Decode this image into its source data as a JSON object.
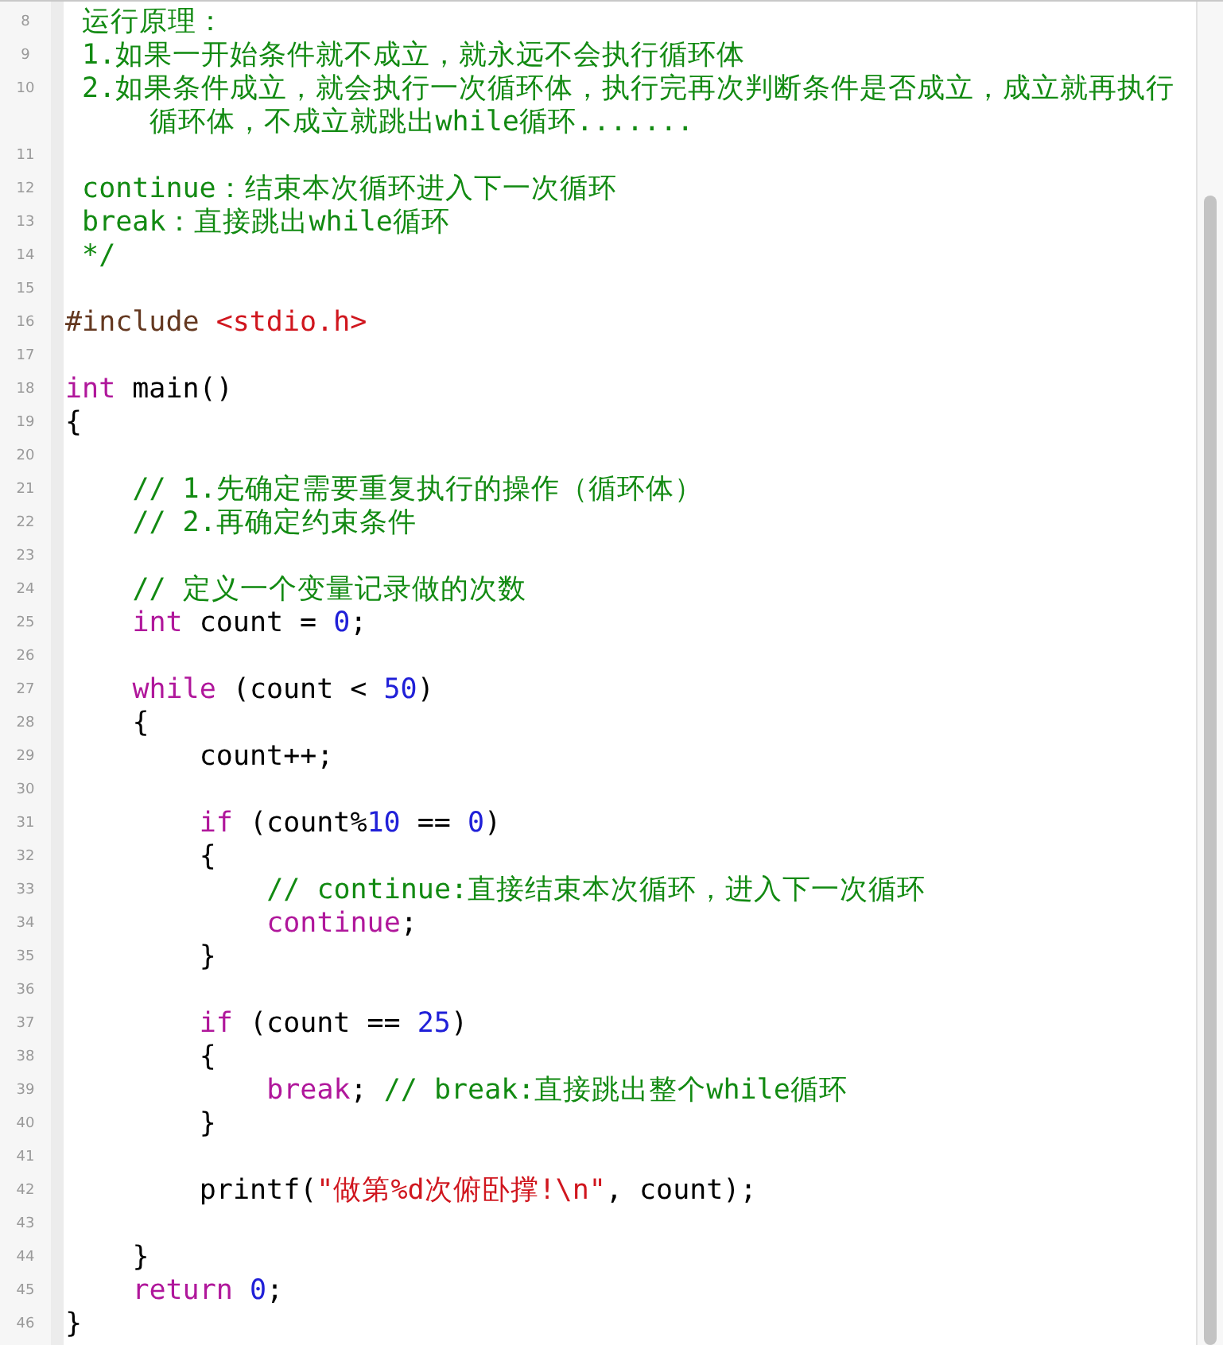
{
  "editor": {
    "lines": [
      {
        "number": "8",
        "kind": "doc",
        "tokens": [
          {
            "kind": "comment",
            "text": "运行原理："
          }
        ]
      },
      {
        "number": "9",
        "kind": "doc",
        "tokens": [
          {
            "kind": "comment",
            "text": "1.如果一开始条件就不成立，就永远不会执行循环体"
          }
        ]
      },
      {
        "number": "10",
        "kind": "doc",
        "tokens": [
          {
            "kind": "comment",
            "text": "2.如果条件成立，就会执行一次循环体，执行完再次判断条件是否成立，成立就再执行"
          }
        ],
        "continuation": [
          {
            "kind": "comment",
            "text": "循环体，不成立就跳出while循环......."
          }
        ]
      },
      {
        "number": "11",
        "kind": "code"
      },
      {
        "number": "12",
        "kind": "doc",
        "tokens": [
          {
            "kind": "comment",
            "text": "continue：结束本次循环进入下一次循环"
          }
        ]
      },
      {
        "number": "13",
        "kind": "doc",
        "tokens": [
          {
            "kind": "comment",
            "text": "break：直接跳出while循环"
          }
        ]
      },
      {
        "number": "14",
        "kind": "doc",
        "tokens": [
          {
            "kind": "comment",
            "text": "*/"
          }
        ]
      },
      {
        "number": "15",
        "kind": "code"
      },
      {
        "number": "16",
        "kind": "code",
        "tokens": [
          {
            "kind": "preprocessor",
            "text": "#include "
          },
          {
            "kind": "string",
            "text": "<stdio.h>"
          }
        ]
      },
      {
        "number": "17",
        "kind": "code"
      },
      {
        "number": "18",
        "kind": "code",
        "tokens": [
          {
            "kind": "keyword",
            "text": "int"
          },
          {
            "kind": "plain",
            "text": " main()"
          }
        ]
      },
      {
        "number": "19",
        "kind": "code",
        "tokens": [
          {
            "kind": "plain",
            "text": "{"
          }
        ],
        "children": [
          {
            "number": "20",
            "kind": "code"
          },
          {
            "number": "21",
            "kind": "code",
            "tokens": [
              {
                "kind": "comment",
                "text": "// 1.先确定需要重复执行的操作（循环体）"
              }
            ]
          },
          {
            "number": "22",
            "kind": "code",
            "tokens": [
              {
                "kind": "comment",
                "text": "// 2.再确定约束条件"
              }
            ]
          },
          {
            "number": "23",
            "kind": "code"
          },
          {
            "number": "24",
            "kind": "code",
            "tokens": [
              {
                "kind": "comment",
                "text": "// 定义一个变量记录做的次数"
              }
            ]
          },
          {
            "number": "25",
            "kind": "code",
            "tokens": [
              {
                "kind": "keyword",
                "text": "int"
              },
              {
                "kind": "plain",
                "text": " count = "
              },
              {
                "kind": "number",
                "text": "0"
              },
              {
                "kind": "plain",
                "text": ";"
              }
            ]
          },
          {
            "number": "26",
            "kind": "code"
          },
          {
            "number": "27",
            "kind": "code",
            "tokens": [
              {
                "kind": "keyword",
                "text": "while"
              },
              {
                "kind": "plain",
                "text": " (count < "
              },
              {
                "kind": "number",
                "text": "50"
              },
              {
                "kind": "plain",
                "text": ")"
              }
            ]
          },
          {
            "number": "28",
            "kind": "code",
            "tokens": [
              {
                "kind": "plain",
                "text": "{"
              }
            ],
            "children": [
              {
                "number": "29",
                "kind": "code",
                "tokens": [
                  {
                    "kind": "plain",
                    "text": "count++;"
                  }
                ]
              },
              {
                "number": "30",
                "kind": "code"
              },
              {
                "number": "31",
                "kind": "code",
                "tokens": [
                  {
                    "kind": "keyword",
                    "text": "if"
                  },
                  {
                    "kind": "plain",
                    "text": " (count%"
                  },
                  {
                    "kind": "number",
                    "text": "10"
                  },
                  {
                    "kind": "plain",
                    "text": " == "
                  },
                  {
                    "kind": "number",
                    "text": "0"
                  },
                  {
                    "kind": "plain",
                    "text": ")"
                  }
                ]
              },
              {
                "number": "32",
                "kind": "code",
                "tokens": [
                  {
                    "kind": "plain",
                    "text": "{"
                  }
                ],
                "children": [
                  {
                    "number": "33",
                    "kind": "code",
                    "tokens": [
                      {
                        "kind": "comment",
                        "text": "// continue:直接结束本次循环，进入下一次循环"
                      }
                    ]
                  },
                  {
                    "number": "34",
                    "kind": "code",
                    "tokens": [
                      {
                        "kind": "keyword",
                        "text": "continue"
                      },
                      {
                        "kind": "plain",
                        "text": ";"
                      }
                    ]
                  }
                ]
              },
              {
                "number": "35",
                "kind": "code",
                "tokens": [
                  {
                    "kind": "plain",
                    "text": "}"
                  }
                ]
              },
              {
                "number": "36",
                "kind": "code"
              },
              {
                "number": "37",
                "kind": "code",
                "tokens": [
                  {
                    "kind": "keyword",
                    "text": "if"
                  },
                  {
                    "kind": "plain",
                    "text": " (count == "
                  },
                  {
                    "kind": "number",
                    "text": "25"
                  },
                  {
                    "kind": "plain",
                    "text": ")"
                  }
                ]
              },
              {
                "number": "38",
                "kind": "code",
                "tokens": [
                  {
                    "kind": "plain",
                    "text": "{"
                  }
                ],
                "children": [
                  {
                    "number": "39",
                    "kind": "code",
                    "tokens": [
                      {
                        "kind": "keyword",
                        "text": "break"
                      },
                      {
                        "kind": "plain",
                        "text": "; "
                      },
                      {
                        "kind": "comment",
                        "text": "// break:直接跳出整个while循环"
                      }
                    ]
                  }
                ]
              },
              {
                "number": "40",
                "kind": "code",
                "tokens": [
                  {
                    "kind": "plain",
                    "text": "}"
                  }
                ]
              },
              {
                "number": "41",
                "kind": "code"
              },
              {
                "number": "42",
                "kind": "code",
                "tokens": [
                  {
                    "kind": "plain",
                    "text": "printf("
                  },
                  {
                    "kind": "string",
                    "text": "\"做第%d次俯卧撑!\\n\""
                  },
                  {
                    "kind": "plain",
                    "text": ", count);"
                  }
                ]
              },
              {
                "number": "43",
                "kind": "code"
              }
            ]
          },
          {
            "number": "44",
            "kind": "code",
            "tokens": [
              {
                "kind": "plain",
                "text": "}"
              }
            ]
          },
          {
            "number": "45",
            "kind": "code",
            "tokens": [
              {
                "kind": "keyword",
                "text": "return "
              },
              {
                "kind": "number",
                "text": "0"
              },
              {
                "kind": "plain",
                "text": ";"
              }
            ]
          }
        ]
      },
      {
        "number": "46",
        "kind": "code",
        "tokens": [
          {
            "kind": "plain",
            "text": "}"
          }
        ]
      }
    ]
  }
}
